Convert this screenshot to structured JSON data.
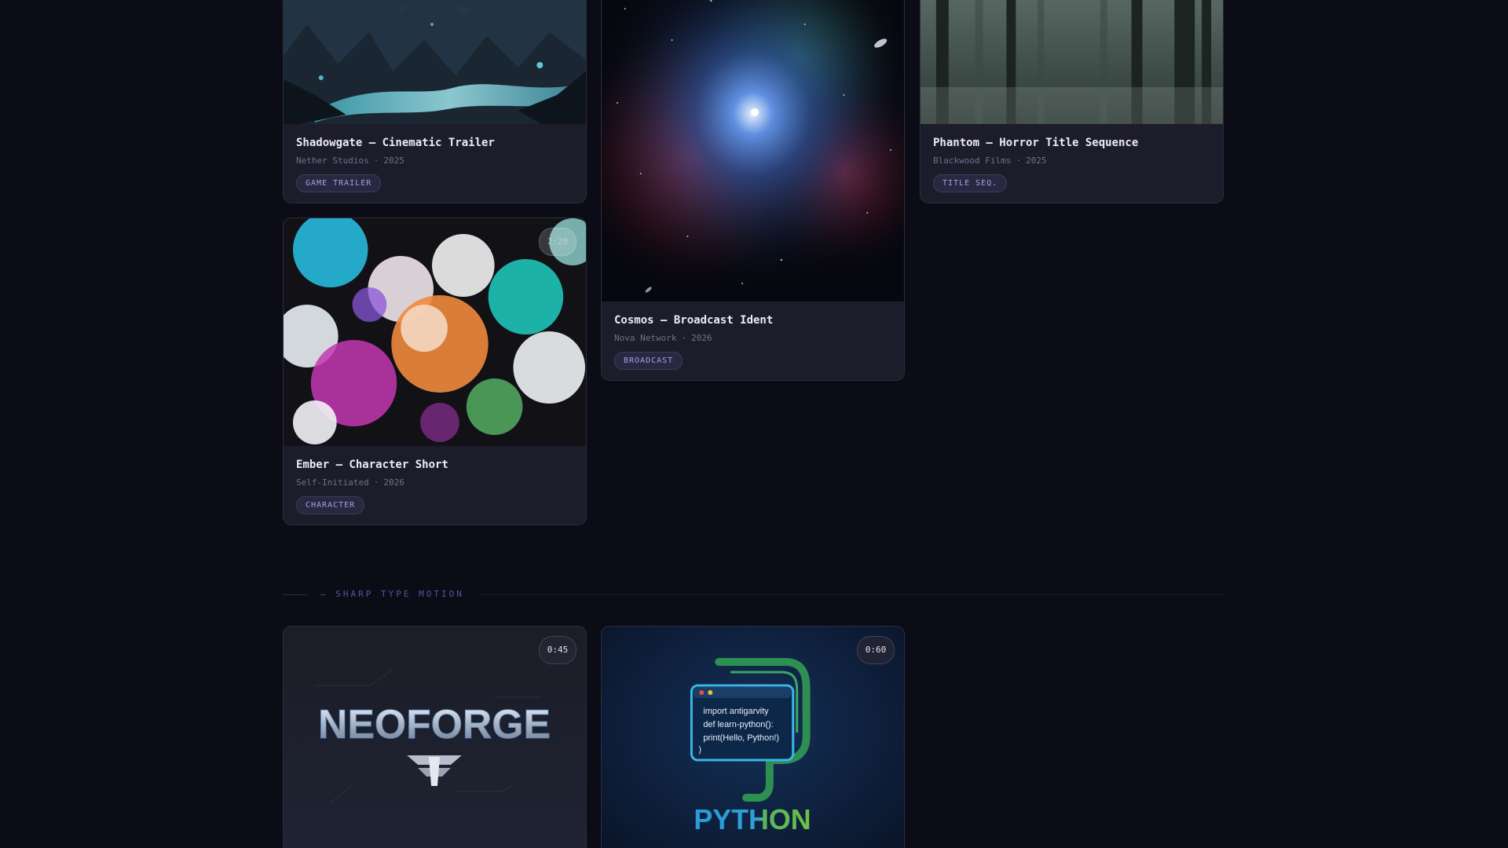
{
  "cards": {
    "shadowgate": {
      "title": "Shadowgate — Cinematic Trailer",
      "client": "Nether Studios",
      "separator": "·",
      "year": "2025",
      "tag": "GAME TRAILER"
    },
    "cosmos": {
      "title": "Cosmos — Broadcast Ident",
      "client": "Nova Network",
      "separator": "·",
      "year": "2026",
      "tag": "BROADCAST"
    },
    "phantom": {
      "title": "Phantom — Horror Title Sequence",
      "client": "Blackwood Films",
      "separator": "·",
      "year": "2025",
      "tag": "TITLE SEQ."
    },
    "ember": {
      "title": "Ember — Character Short",
      "client": "Self-Initiated",
      "separator": "·",
      "year": "2026",
      "tag": "CHARACTER",
      "duration": "2:20"
    },
    "neoforge": {
      "duration": "0:45",
      "logo_text": "NEOFORGE"
    },
    "python": {
      "duration": "0:60",
      "logo_text": "PYTHON",
      "code_lines": [
        "import antigarvity",
        "def learn-python():",
        "print(Hello, Python!)",
        ")"
      ]
    }
  },
  "section": {
    "label": "— SHARP TYPE MOTION"
  },
  "colors": {
    "background": "#0c0c16",
    "card": "#1d1c2b",
    "tag_text": "#a79ee8",
    "section_label": "#5a53a6"
  }
}
